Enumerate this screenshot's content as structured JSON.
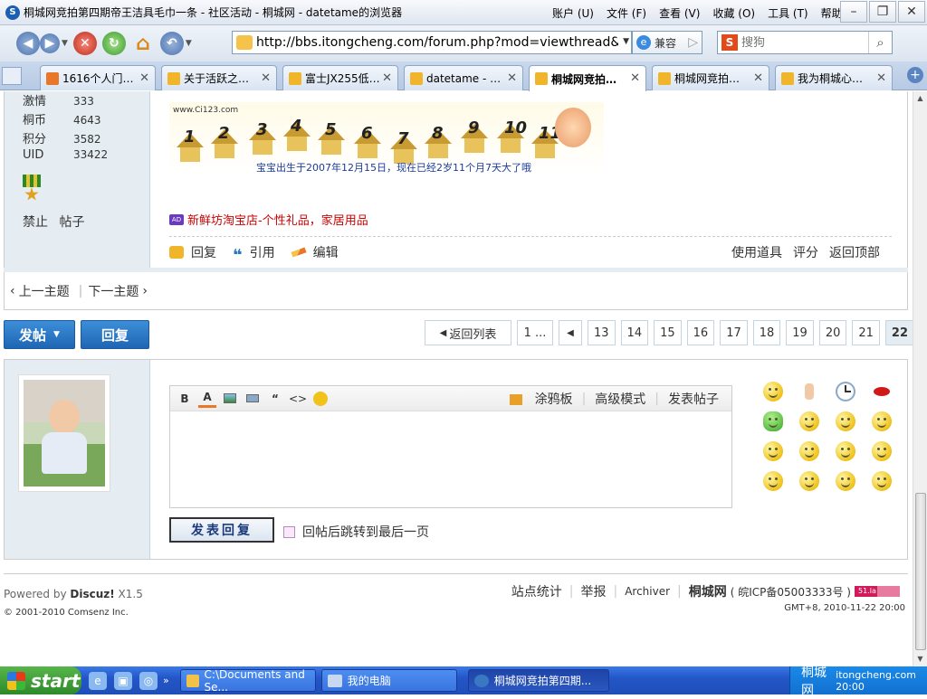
{
  "window": {
    "title": "桐城网竞拍第四期帝王洁具毛巾一条 - 社区活动 - 桐城网 - datetame的浏览器",
    "menus": [
      "账户 (U)",
      "文件 (F)",
      "查看 (V)",
      "收藏 (O)",
      "工具 (T)",
      "帮助 (H)"
    ]
  },
  "toolbar": {
    "url": "http://bbs.itongcheng.com/forum.php?mod=viewthread&tid=",
    "compat_label": "兼容",
    "search_placeholder": "搜狗"
  },
  "tabs": [
    {
      "label": "1616个人门…",
      "active": false
    },
    {
      "label": "关于活跃之…",
      "active": false
    },
    {
      "label": "富士JX255低…",
      "active": false
    },
    {
      "label": "datetame - …",
      "active": false
    },
    {
      "label": "桐城网竞拍…",
      "active": true
    },
    {
      "label": "桐城网竞拍…",
      "active": false
    },
    {
      "label": "我为桐城心…",
      "active": false
    }
  ],
  "post": {
    "stats": [
      {
        "label": "激情",
        "value": "333"
      },
      {
        "label": "桐币",
        "value": "4643"
      },
      {
        "label": "积分",
        "value": "3582"
      },
      {
        "label": "UID",
        "value": "33422"
      }
    ],
    "side_links": [
      "禁止",
      "帖子"
    ],
    "banner": {
      "site": "www.Ci123.com",
      "numbers": [
        "1",
        "2",
        "3",
        "4",
        "5",
        "6",
        "7",
        "8",
        "9",
        "10",
        "11"
      ],
      "caption": "宝宝出生于2007年12月15日，现在已经2岁11个月7天大了哦"
    },
    "ad_badge": "AD",
    "ad_text": "新鲜坊淘宝店-个性礼品，家居用品",
    "actions": [
      "回复",
      "引用",
      "编辑"
    ],
    "tools": [
      "使用道具",
      "评分",
      "返回顶部"
    ]
  },
  "thread_nav": {
    "prev": "上一主题",
    "next": "下一主题"
  },
  "buttons": {
    "new_post": "发帖",
    "reply": "回复"
  },
  "pager": {
    "back": "返回列表",
    "first": "1 ...",
    "pages": [
      "13",
      "14",
      "15",
      "16",
      "17",
      "18",
      "19",
      "20",
      "21",
      "22"
    ],
    "current": "22"
  },
  "reply": {
    "editor_buttons": [
      "B",
      "A"
    ],
    "editor_right": [
      "涂鸦板",
      "高级模式",
      "发表帖子"
    ],
    "submit": "发表回复",
    "jump_label": "回帖后跳转到最后一页"
  },
  "footer": {
    "powered_prefix": "Powered by ",
    "powered_brand": "Discuz!",
    "powered_version": " X1.5",
    "copyright": "© 2001-2010 Comsenz Inc.",
    "links": [
      "站点统计",
      "举报",
      "Archiver"
    ],
    "site_name": "桐城网",
    "icp": "( 皖ICP备05003333号 )",
    "badge": "51.la",
    "gmt": "GMT+8, 2010-11-22 20:00"
  },
  "taskbar": {
    "start": "start",
    "tasks": [
      "C:\\Documents and Se...",
      "我的电脑",
      "桐城网竞拍第四期..."
    ],
    "tray_text": "桐城网",
    "clock": "itongcheng.com 20:00"
  }
}
